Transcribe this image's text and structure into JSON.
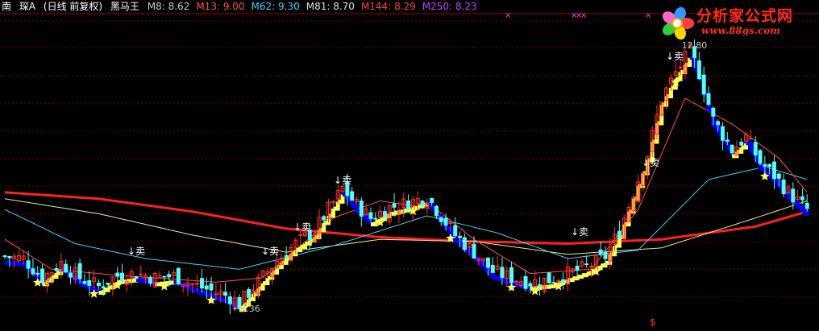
{
  "header": {
    "title_prefix": "南",
    "stock_name": "琛A",
    "period": "(日线 前复权)",
    "indicator_name": "黑马王",
    "indicators": [
      {
        "label": "M8:",
        "value": "8.62",
        "color": "#c8c8c8"
      },
      {
        "label": "M13:",
        "value": "9.00",
        "color": "#ff5050"
      },
      {
        "label": "M62:",
        "value": "9.30",
        "color": "#40d0ff"
      },
      {
        "label": "M81:",
        "value": "8.70",
        "color": "#e0e0e0"
      },
      {
        "label": "M144:",
        "value": "8.29",
        "color": "#ff4040"
      },
      {
        "label": "M250:",
        "value": "8.23",
        "color": "#c040ff"
      }
    ]
  },
  "logo": {
    "title": "分析家公式网",
    "url": "www.88gs.com",
    "colors": {
      "title": "#ff2a1e",
      "petals": [
        "#ff3d3d",
        "#ffd400",
        "#33cc33",
        "#ff66cc",
        "#3399ff"
      ]
    }
  },
  "annotations": {
    "high_label": "12.80",
    "low_label": "←6.36",
    "sell_label": "↓卖",
    "bottom_marker": "$"
  },
  "colors": {
    "up": "#ff3232",
    "down": "#54fcfc",
    "trend_up": "#ffff54",
    "trend_down": "#0000ff",
    "star": "#ffff54",
    "ma_m8": "#ffffff",
    "ma_m13": "#ff5050",
    "ma_m62": "#40d0ff",
    "ma_m81": "#e8e8a0",
    "ma_m144": "#ff2020",
    "grid": "#7a0000"
  },
  "chart_data": {
    "type": "candlestick",
    "y_range": [
      6.0,
      13.2
    ],
    "x_count": 172,
    "low_point": {
      "index": 50,
      "value": 6.36
    },
    "high_point": {
      "index": 146,
      "value": 12.8
    },
    "anchors": [
      [
        0,
        7.5
      ],
      [
        4,
        7.45
      ],
      [
        8,
        7.0
      ],
      [
        12,
        7.35
      ],
      [
        16,
        7.0
      ],
      [
        20,
        6.8
      ],
      [
        24,
        7.05
      ],
      [
        28,
        7.1
      ],
      [
        32,
        7.0
      ],
      [
        36,
        7.05
      ],
      [
        40,
        6.85
      ],
      [
        44,
        6.7
      ],
      [
        48,
        6.55
      ],
      [
        50,
        6.4
      ],
      [
        54,
        6.9
      ],
      [
        58,
        7.4
      ],
      [
        62,
        7.8
      ],
      [
        66,
        8.1
      ],
      [
        69,
        8.6
      ],
      [
        72,
        9.1
      ],
      [
        75,
        8.7
      ],
      [
        78,
        8.4
      ],
      [
        82,
        8.65
      ],
      [
        86,
        8.75
      ],
      [
        90,
        8.9
      ],
      [
        94,
        8.3
      ],
      [
        96,
        8.0
      ],
      [
        100,
        7.6
      ],
      [
        104,
        7.15
      ],
      [
        108,
        7.0
      ],
      [
        112,
        6.9
      ],
      [
        116,
        6.95
      ],
      [
        120,
        7.1
      ],
      [
        124,
        7.25
      ],
      [
        128,
        7.5
      ],
      [
        131,
        8.1
      ],
      [
        134,
        9.0
      ],
      [
        137,
        9.9
      ],
      [
        140,
        11.2
      ],
      [
        143,
        11.8
      ],
      [
        146,
        12.3
      ],
      [
        148,
        11.8
      ],
      [
        151,
        10.7
      ],
      [
        155,
        10.0
      ],
      [
        158,
        10.3
      ],
      [
        161,
        9.7
      ],
      [
        164,
        9.4
      ],
      [
        167,
        9.0
      ],
      [
        170,
        8.7
      ],
      [
        171,
        8.6
      ]
    ],
    "moving_averages": [
      {
        "name": "M144",
        "anchors": [
          [
            0,
            9.0
          ],
          [
            20,
            8.85
          ],
          [
            40,
            8.55
          ],
          [
            60,
            8.15
          ],
          [
            80,
            7.95
          ],
          [
            100,
            7.85
          ],
          [
            120,
            7.8
          ],
          [
            140,
            7.9
          ],
          [
            160,
            8.2
          ],
          [
            171,
            8.55
          ]
        ]
      },
      {
        "name": "M81",
        "anchors": [
          [
            0,
            8.85
          ],
          [
            20,
            8.5
          ],
          [
            40,
            8.0
          ],
          [
            60,
            7.6
          ],
          [
            80,
            7.9
          ],
          [
            100,
            7.85
          ],
          [
            120,
            7.55
          ],
          [
            140,
            7.7
          ],
          [
            160,
            8.4
          ],
          [
            171,
            8.8
          ]
        ]
      },
      {
        "name": "M62",
        "anchors": [
          [
            0,
            8.6
          ],
          [
            15,
            7.8
          ],
          [
            30,
            7.45
          ],
          [
            50,
            7.2
          ],
          [
            70,
            7.75
          ],
          [
            90,
            8.45
          ],
          [
            105,
            8.05
          ],
          [
            120,
            7.45
          ],
          [
            135,
            7.65
          ],
          [
            150,
            9.3
          ],
          [
            162,
            9.6
          ],
          [
            171,
            9.3
          ]
        ]
      },
      {
        "name": "M13",
        "anchors": [
          [
            0,
            7.9
          ],
          [
            10,
            7.2
          ],
          [
            25,
            7.05
          ],
          [
            45,
            6.9
          ],
          [
            55,
            7.0
          ],
          [
            70,
            8.4
          ],
          [
            80,
            8.8
          ],
          [
            92,
            8.6
          ],
          [
            100,
            7.9
          ],
          [
            112,
            7.1
          ],
          [
            125,
            7.2
          ],
          [
            135,
            8.6
          ],
          [
            145,
            11.2
          ],
          [
            155,
            10.6
          ],
          [
            165,
            9.8
          ],
          [
            171,
            9.0
          ]
        ]
      }
    ]
  }
}
